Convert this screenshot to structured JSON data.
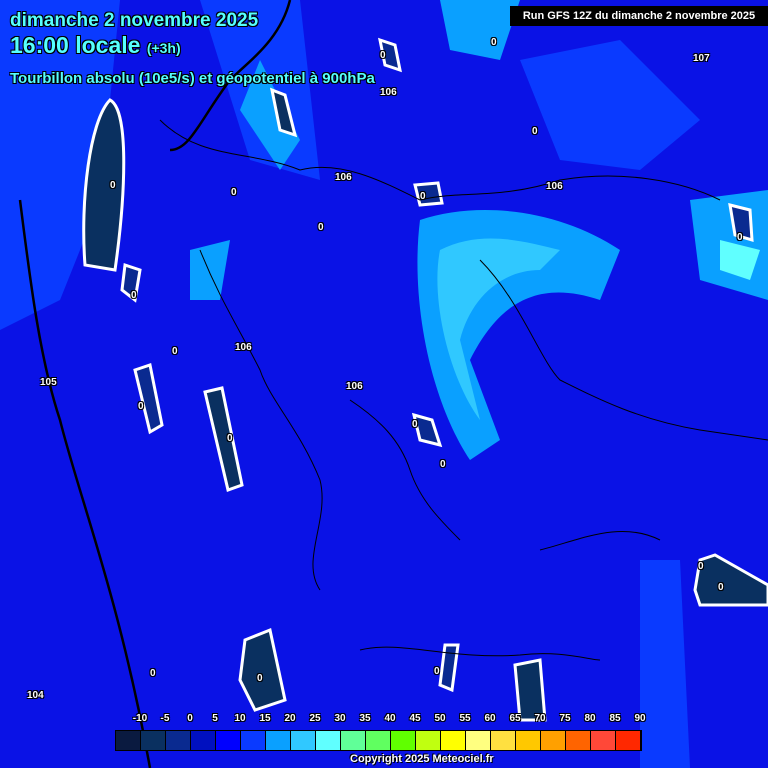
{
  "header": {
    "date": "dimanche 2 novembre 2025",
    "time": "16:00 locale",
    "step": "(+3h)",
    "variable": "Tourbillon absolu (10e5/s) et géopotentiel à 900hPa",
    "run": "Run GFS 12Z du dimanche 2 novembre 2025"
  },
  "contour_labels": {
    "geopotential": [
      "107",
      "106",
      "106",
      "106",
      "106",
      "106",
      "105",
      "104"
    ],
    "vorticity": "0"
  },
  "legend": {
    "ticks": [
      "-10",
      "-5",
      "0",
      "5",
      "10",
      "15",
      "20",
      "25",
      "30",
      "35",
      "40",
      "45",
      "50",
      "55",
      "60",
      "65",
      "70",
      "75",
      "80",
      "85",
      "90"
    ],
    "colors": [
      "#0a1a40",
      "#0a3060",
      "#0a2a90",
      "#0010c0",
      "#0000ff",
      "#0a3aff",
      "#0aa0ff",
      "#30c8ff",
      "#60ffff",
      "#60ff98",
      "#60ff60",
      "#60ff00",
      "#c0ff10",
      "#ffff00",
      "#ffff80",
      "#ffe040",
      "#ffc800",
      "#ffa000",
      "#ff6400",
      "#ff4838",
      "#ff2800"
    ]
  },
  "copyright": "Copyright 2025 Meteociel.fr"
}
